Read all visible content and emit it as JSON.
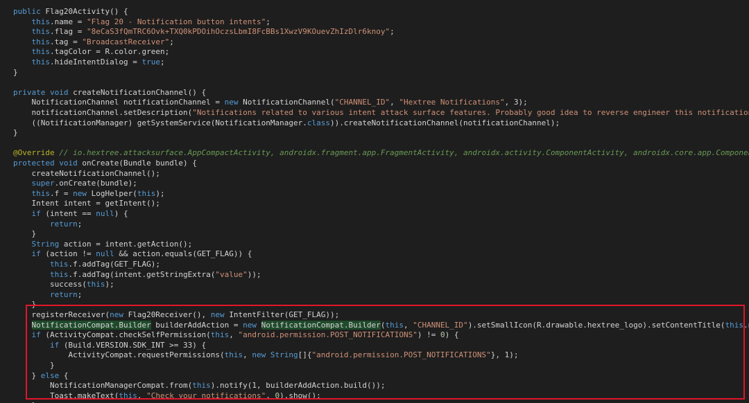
{
  "palette": {
    "background": "#1e1e1e",
    "text": "#d4d4d4",
    "keyword": "#569cd6",
    "string": "#ce9178",
    "annotation": "#bbb529",
    "comment": "#6a9955",
    "highlight_bg": "#1f4a2b",
    "highlight_box": "#e0162b"
  },
  "code_lines": [
    [
      [
        "kw",
        "public"
      ],
      [
        "t",
        " Flag20Activity() {"
      ]
    ],
    [
      [
        "t",
        "    "
      ],
      [
        "kw",
        "this"
      ],
      [
        "t",
        ".name = "
      ],
      [
        "str",
        "\"Flag 20 - Notification button intents\""
      ],
      [
        "t",
        ";"
      ]
    ],
    [
      [
        "t",
        "    "
      ],
      [
        "kw",
        "this"
      ],
      [
        "t",
        ".flag = "
      ],
      [
        "str",
        "\"8eCaS3fQmTRC6Ovk+TXQ0kPDOihOczsLbmI8FcBBs1XwzV9KOuevZhIzDlr6knoy\""
      ],
      [
        "t",
        ";"
      ]
    ],
    [
      [
        "t",
        "    "
      ],
      [
        "kw",
        "this"
      ],
      [
        "t",
        ".tag = "
      ],
      [
        "str",
        "\"BroadcastReceiver\""
      ],
      [
        "t",
        ";"
      ]
    ],
    [
      [
        "t",
        "    "
      ],
      [
        "kw",
        "this"
      ],
      [
        "t",
        ".tagColor = R.color.green;"
      ]
    ],
    [
      [
        "t",
        "    "
      ],
      [
        "kw",
        "this"
      ],
      [
        "t",
        ".hideIntentDialog = "
      ],
      [
        "kw",
        "true"
      ],
      [
        "t",
        ";"
      ]
    ],
    [
      [
        "t",
        "}"
      ]
    ],
    [],
    [
      [
        "kw",
        "private"
      ],
      [
        "t",
        " "
      ],
      [
        "kw",
        "void"
      ],
      [
        "t",
        " createNotificationChannel() {"
      ]
    ],
    [
      [
        "t",
        "    NotificationChannel notificationChannel = "
      ],
      [
        "kw",
        "new"
      ],
      [
        "t",
        " NotificationChannel("
      ],
      [
        "str",
        "\"CHANNEL_ID\""
      ],
      [
        "t",
        ", "
      ],
      [
        "str",
        "\"Hextree Notifications\""
      ],
      [
        "t",
        ", 3);"
      ]
    ],
    [
      [
        "t",
        "    notificationChannel.setDescription("
      ],
      [
        "str",
        "\"Notifications related to various intent attack surface features. Probably good idea to reverse engineer this notification.\""
      ],
      [
        "t",
        ");"
      ]
    ],
    [
      [
        "t",
        "    ((NotificationManager) getSystemService(NotificationManager."
      ],
      [
        "kw",
        "class"
      ],
      [
        "t",
        ")).createNotificationChannel(notificationChannel);"
      ]
    ],
    [
      [
        "t",
        "}"
      ]
    ],
    [],
    [
      [
        "ann",
        "@Override"
      ],
      [
        "t",
        " "
      ],
      [
        "cm",
        "// io.hextree.attacksurface.AppCompactActivity, androidx.fragment.app.FragmentActivity, androidx.activity.ComponentActivity, androidx.core.app.ComponentActivity"
      ]
    ],
    [
      [
        "kw",
        "protected"
      ],
      [
        "t",
        " "
      ],
      [
        "kw",
        "void"
      ],
      [
        "t",
        " onCreate(Bundle bundle) {"
      ]
    ],
    [
      [
        "t",
        "    createNotificationChannel();"
      ]
    ],
    [
      [
        "t",
        "    "
      ],
      [
        "kw",
        "super"
      ],
      [
        "t",
        ".onCreate(bundle);"
      ]
    ],
    [
      [
        "t",
        "    "
      ],
      [
        "kw",
        "this"
      ],
      [
        "t",
        ".f = "
      ],
      [
        "kw",
        "new"
      ],
      [
        "t",
        " LogHelper("
      ],
      [
        "kw",
        "this"
      ],
      [
        "t",
        ");"
      ]
    ],
    [
      [
        "t",
        "    Intent intent = getIntent();"
      ]
    ],
    [
      [
        "t",
        "    "
      ],
      [
        "kw",
        "if"
      ],
      [
        "t",
        " (intent == "
      ],
      [
        "kw",
        "null"
      ],
      [
        "t",
        ") {"
      ]
    ],
    [
      [
        "t",
        "        "
      ],
      [
        "kw",
        "return"
      ],
      [
        "t",
        ";"
      ]
    ],
    [
      [
        "t",
        "    }"
      ]
    ],
    [
      [
        "t",
        "    "
      ],
      [
        "kw",
        "String"
      ],
      [
        "t",
        " action = intent.getAction();"
      ]
    ],
    [
      [
        "t",
        "    "
      ],
      [
        "kw",
        "if"
      ],
      [
        "t",
        " (action != "
      ],
      [
        "kw",
        "null"
      ],
      [
        "t",
        " && action.equals(GET_FLAG)) {"
      ]
    ],
    [
      [
        "t",
        "        "
      ],
      [
        "kw",
        "this"
      ],
      [
        "t",
        ".f.addTag(GET_FLAG);"
      ]
    ],
    [
      [
        "t",
        "        "
      ],
      [
        "kw",
        "this"
      ],
      [
        "t",
        ".f.addTag(intent.getStringExtra("
      ],
      [
        "str",
        "\"value\""
      ],
      [
        "t",
        "));"
      ]
    ],
    [
      [
        "t",
        "        success("
      ],
      [
        "kw",
        "this"
      ],
      [
        "t",
        ");"
      ]
    ],
    [
      [
        "t",
        "        "
      ],
      [
        "kw",
        "return"
      ],
      [
        "t",
        ";"
      ]
    ],
    [
      [
        "t",
        "    }"
      ]
    ],
    [
      [
        "t",
        "    registerReceiver("
      ],
      [
        "kw",
        "new"
      ],
      [
        "t",
        " Flag20Receiver(), "
      ],
      [
        "kw",
        "new"
      ],
      [
        "t",
        " IntentFilter(GET_FLAG));"
      ]
    ],
    [
      [
        "t",
        "    "
      ],
      [
        "hl",
        "NotificationCompat.Builder"
      ],
      [
        "t",
        " builderAddAction = "
      ],
      [
        "kw",
        "new"
      ],
      [
        "t",
        " "
      ],
      [
        "hl",
        "NotificationCompat.Builder"
      ],
      [
        "t",
        "("
      ],
      [
        "kw",
        "this"
      ],
      [
        "t",
        ", "
      ],
      [
        "str",
        "\"CHANNEL_ID\""
      ],
      [
        "t",
        ").setSmallIcon(R.drawable.hextree_logo).setContentTitle("
      ],
      [
        "kw",
        "this"
      ],
      [
        "t",
        ".name).setContentText("
      ],
      [
        "str",
        "\"Reverse engineer this notification\""
      ],
      [
        "t",
        ");"
      ]
    ],
    [
      [
        "t",
        "    "
      ],
      [
        "kw",
        "if"
      ],
      [
        "t",
        " (ActivityCompat.checkSelfPermission("
      ],
      [
        "kw",
        "this"
      ],
      [
        "t",
        ", "
      ],
      [
        "str",
        "\"android.permission.POST_NOTIFICATIONS\""
      ],
      [
        "t",
        ") != "
      ],
      [
        "num",
        "0"
      ],
      [
        "t",
        ") {"
      ]
    ],
    [
      [
        "t",
        "        "
      ],
      [
        "kw",
        "if"
      ],
      [
        "t",
        " (Build.VERSION.SDK_INT >= 33) {"
      ]
    ],
    [
      [
        "t",
        "            ActivityCompat.requestPermissions("
      ],
      [
        "kw",
        "this"
      ],
      [
        "t",
        ", "
      ],
      [
        "kw",
        "new"
      ],
      [
        "t",
        " "
      ],
      [
        "kw",
        "String"
      ],
      [
        "t",
        "[]{"
      ],
      [
        "str",
        "\"android.permission.POST_NOTIFICATIONS\""
      ],
      [
        "t",
        "}, 1);"
      ]
    ],
    [
      [
        "t",
        "        }"
      ]
    ],
    [
      [
        "t",
        "    } "
      ],
      [
        "kw",
        "else"
      ],
      [
        "t",
        " {"
      ]
    ],
    [
      [
        "t",
        "        NotificationManagerCompat.from("
      ],
      [
        "kw",
        "this"
      ],
      [
        "t",
        ").notify(1, builderAddAction.build());"
      ]
    ],
    [
      [
        "t",
        "        Toast.makeText("
      ],
      [
        "kw",
        "this"
      ],
      [
        "t",
        ", "
      ],
      [
        "str",
        "\"Check your notifications\""
      ],
      [
        "t",
        ", "
      ],
      [
        "num",
        "0"
      ],
      [
        "t",
        ").show();"
      ]
    ],
    [
      [
        "t",
        "    }"
      ]
    ]
  ]
}
